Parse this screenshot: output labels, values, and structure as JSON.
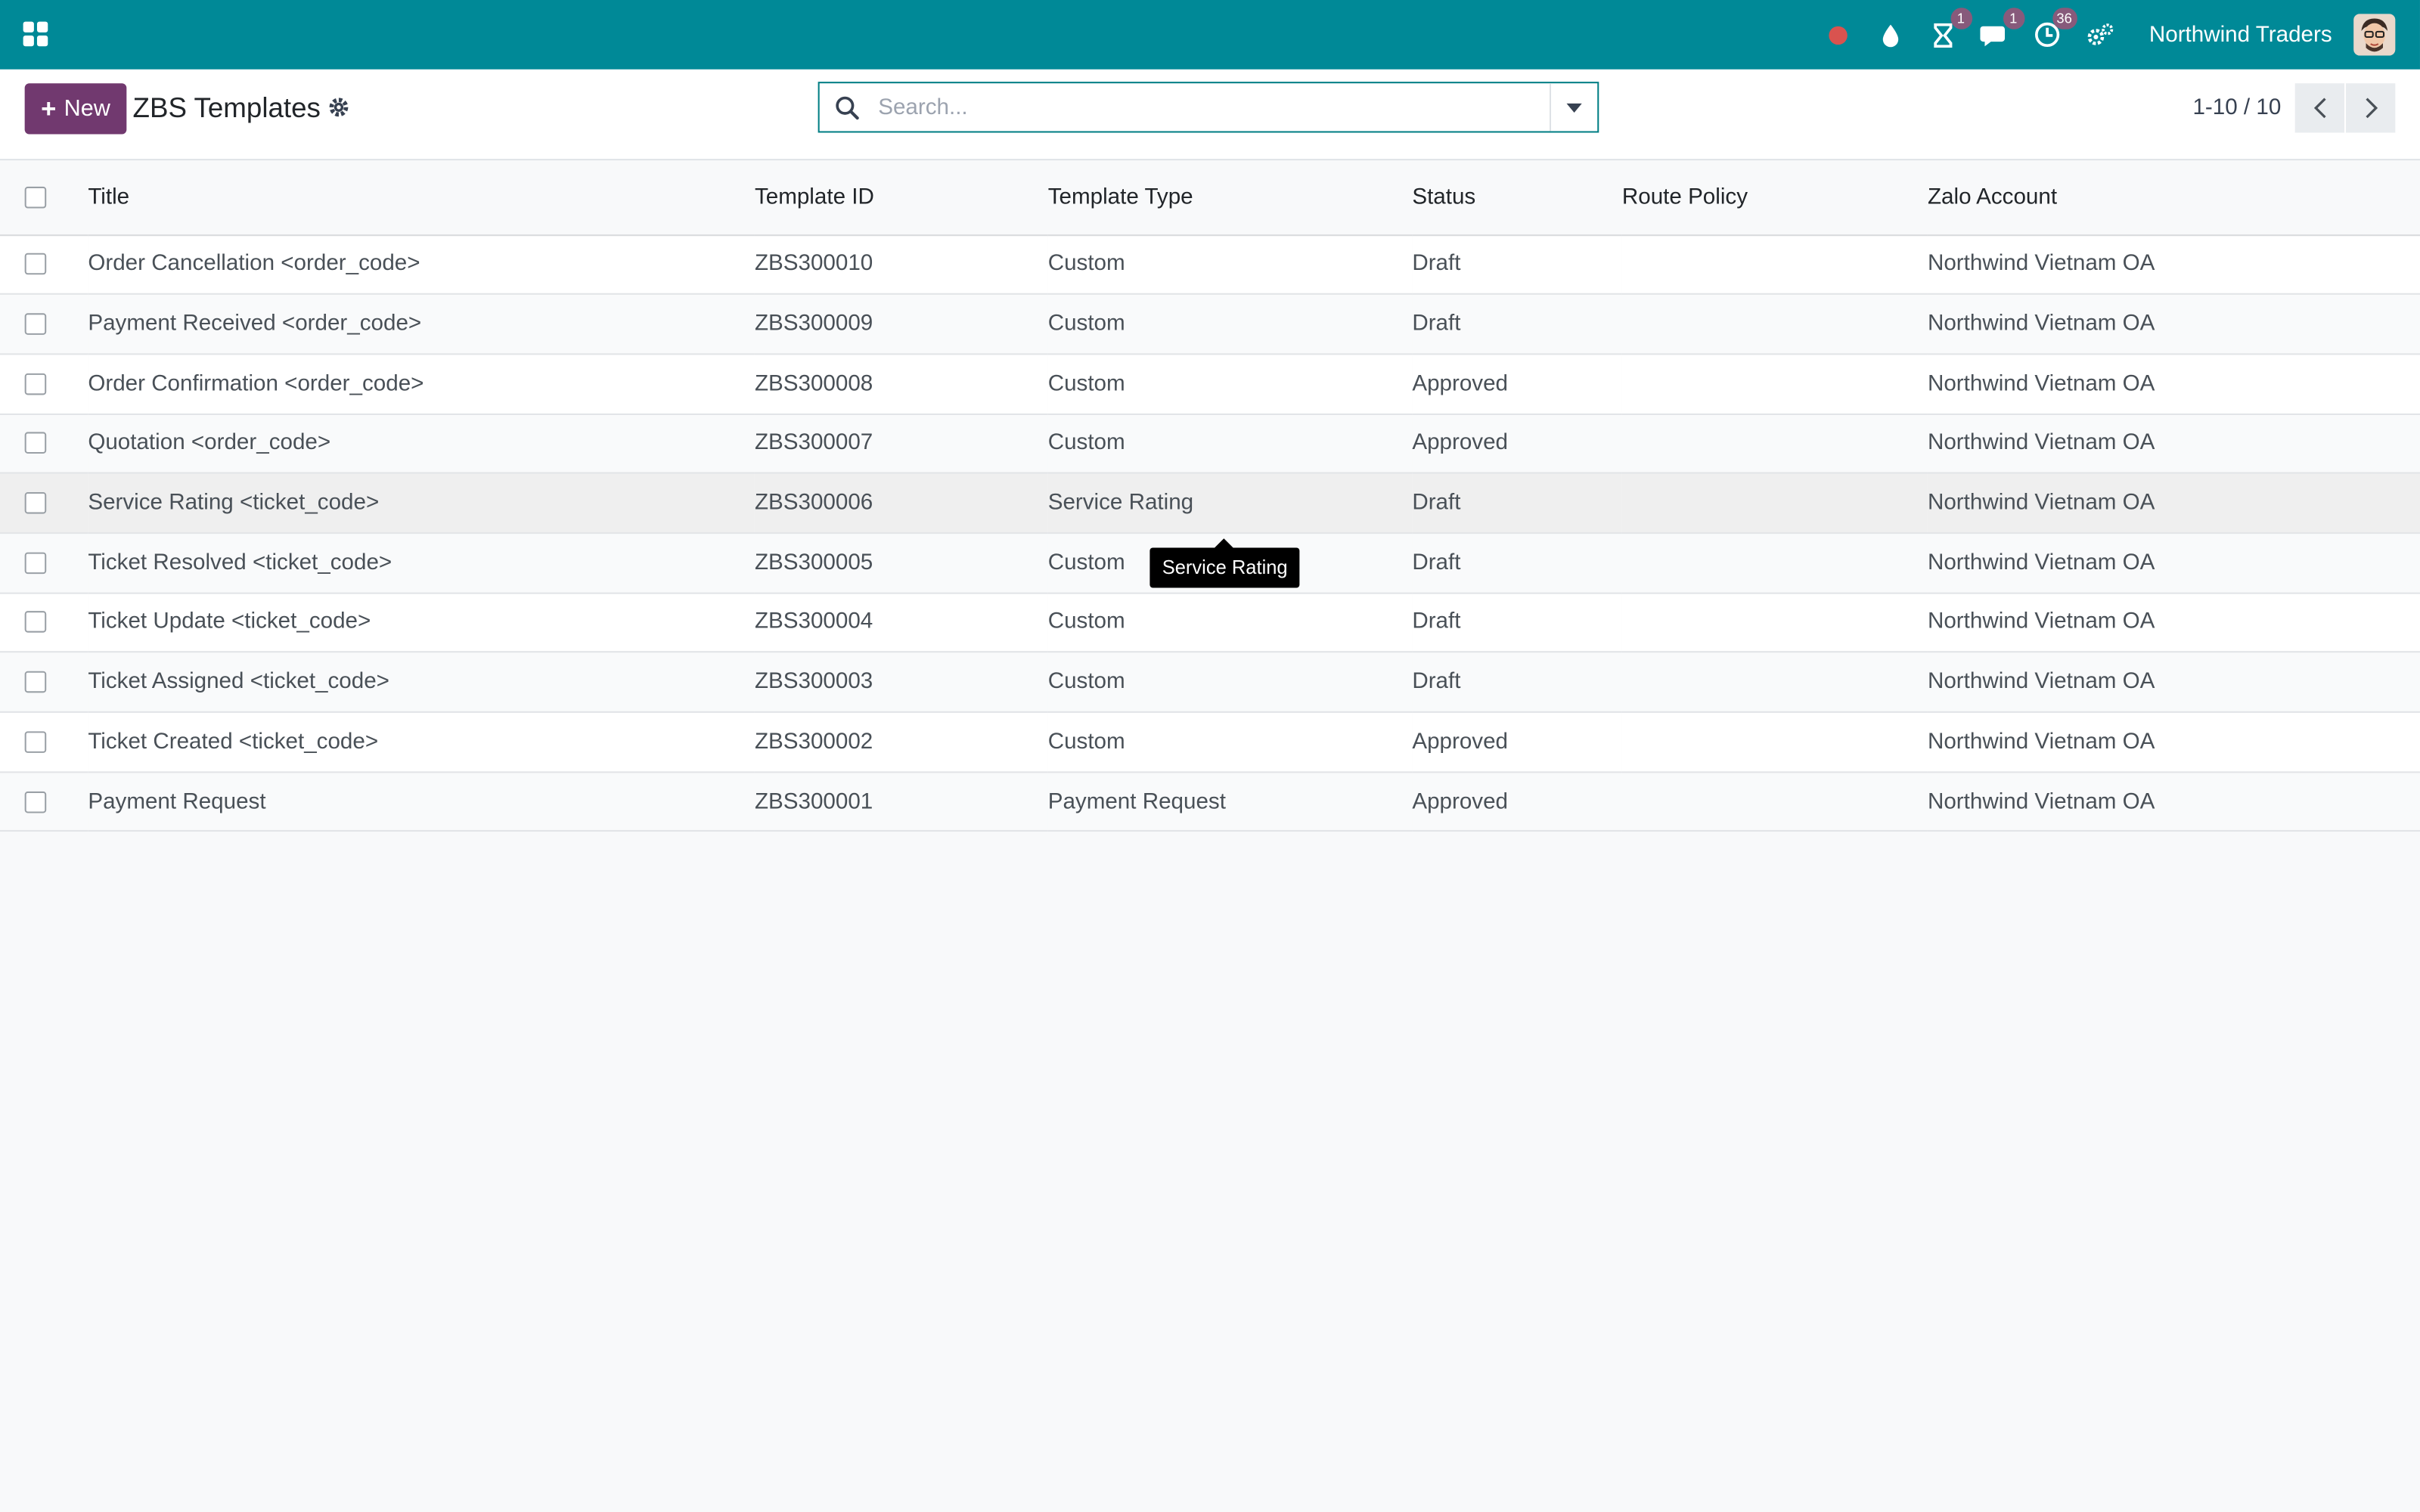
{
  "navbar": {
    "company": "Northwind Traders",
    "badges": {
      "activities": "1",
      "messages": "1",
      "clock": "36"
    },
    "colors": {
      "bar": "#008997",
      "badge": "#875a7b",
      "status_dot": "#d9534f"
    }
  },
  "control_panel": {
    "new_label": "New",
    "title": "ZBS Templates",
    "search_placeholder": "Search...",
    "pager": "1-10 / 10",
    "new_button_color": "#71396f"
  },
  "table": {
    "columns": [
      "Title",
      "Template ID",
      "Template Type",
      "Status",
      "Route Policy",
      "Zalo Account"
    ],
    "rows": [
      {
        "title": "Order Cancellation <order_code>",
        "template_id": "ZBS300010",
        "template_type": "Custom",
        "status": "Draft",
        "route_policy": "",
        "zalo_account": "Northwind Vietnam OA"
      },
      {
        "title": "Payment Received <order_code>",
        "template_id": "ZBS300009",
        "template_type": "Custom",
        "status": "Draft",
        "route_policy": "",
        "zalo_account": "Northwind Vietnam OA"
      },
      {
        "title": "Order Confirmation <order_code>",
        "template_id": "ZBS300008",
        "template_type": "Custom",
        "status": "Approved",
        "route_policy": "",
        "zalo_account": "Northwind Vietnam OA"
      },
      {
        "title": "Quotation <order_code>",
        "template_id": "ZBS300007",
        "template_type": "Custom",
        "status": "Approved",
        "route_policy": "",
        "zalo_account": "Northwind Vietnam OA"
      },
      {
        "title": "Service Rating <ticket_code>",
        "template_id": "ZBS300006",
        "template_type": "Service Rating",
        "status": "Draft",
        "route_policy": "",
        "zalo_account": "Northwind Vietnam OA"
      },
      {
        "title": "Ticket Resolved <ticket_code>",
        "template_id": "ZBS300005",
        "template_type": "Custom",
        "status": "Draft",
        "route_policy": "",
        "zalo_account": "Northwind Vietnam OA"
      },
      {
        "title": "Ticket Update <ticket_code>",
        "template_id": "ZBS300004",
        "template_type": "Custom",
        "status": "Draft",
        "route_policy": "",
        "zalo_account": "Northwind Vietnam OA"
      },
      {
        "title": "Ticket Assigned <ticket_code>",
        "template_id": "ZBS300003",
        "template_type": "Custom",
        "status": "Draft",
        "route_policy": "",
        "zalo_account": "Northwind Vietnam OA"
      },
      {
        "title": "Ticket Created <ticket_code>",
        "template_id": "ZBS300002",
        "template_type": "Custom",
        "status": "Approved",
        "route_policy": "",
        "zalo_account": "Northwind Vietnam OA"
      },
      {
        "title": "Payment Request",
        "template_id": "ZBS300001",
        "template_type": "Payment Request",
        "status": "Approved",
        "route_policy": "",
        "zalo_account": "Northwind Vietnam OA"
      }
    ]
  },
  "tooltip": {
    "text": "Service Rating"
  }
}
